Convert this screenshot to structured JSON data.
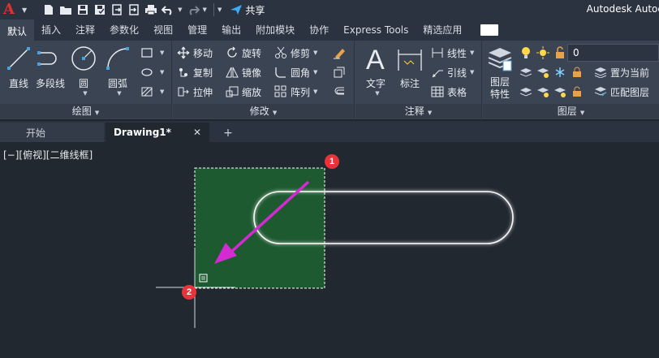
{
  "app": {
    "logo_letter": "A",
    "title": "Autodesk Autoc",
    "share_label": "共享"
  },
  "quick_access": {
    "icons": [
      "new-file-icon",
      "open-icon",
      "save-icon",
      "save-as-icon",
      "export-icon",
      "import-icon",
      "print-icon",
      "undo-icon",
      "redo-icon",
      "share-icon"
    ]
  },
  "ribbon_tabs": [
    {
      "label": "默认",
      "active": true
    },
    {
      "label": "插入"
    },
    {
      "label": "注释"
    },
    {
      "label": "参数化"
    },
    {
      "label": "视图"
    },
    {
      "label": "管理"
    },
    {
      "label": "输出"
    },
    {
      "label": "附加模块"
    },
    {
      "label": "协作"
    },
    {
      "label": "Express Tools"
    },
    {
      "label": "精选应用"
    }
  ],
  "panels": {
    "draw": {
      "title": "绘图",
      "buttons": {
        "line": "直线",
        "polyline": "多段线",
        "circle": "圆",
        "arc": "圆弧"
      }
    },
    "modify": {
      "title": "修改",
      "buttons": {
        "move": "移动",
        "rotate": "旋转",
        "trim": "修剪",
        "copy": "复制",
        "mirror": "镜像",
        "fillet": "圆角",
        "stretch": "拉伸",
        "scale": "缩放",
        "array": "阵列"
      }
    },
    "annotation": {
      "title": "注释",
      "buttons": {
        "text": "文字",
        "dimension": "标注",
        "linear": "线性",
        "leader": "引线",
        "table": "表格"
      }
    },
    "layers": {
      "title": "图层",
      "buttons": {
        "layer_props_line1": "图层",
        "layer_props_line2": "特性",
        "make_current": "置为当前",
        "match_layer": "匹配图层"
      },
      "current_layer": "0"
    }
  },
  "file_tabs": [
    {
      "label": "开始"
    },
    {
      "label": "Drawing1*",
      "active": true,
      "close": "✕"
    }
  ],
  "file_tab_add": "+",
  "viewport": {
    "label": "[−][俯视][二维线框]"
  },
  "markers": [
    "1",
    "2"
  ],
  "colors": {
    "selection_fill": "#1d5a2f",
    "arrow": "#d42ad4",
    "marker": "#e8333a",
    "background": "#212830"
  }
}
